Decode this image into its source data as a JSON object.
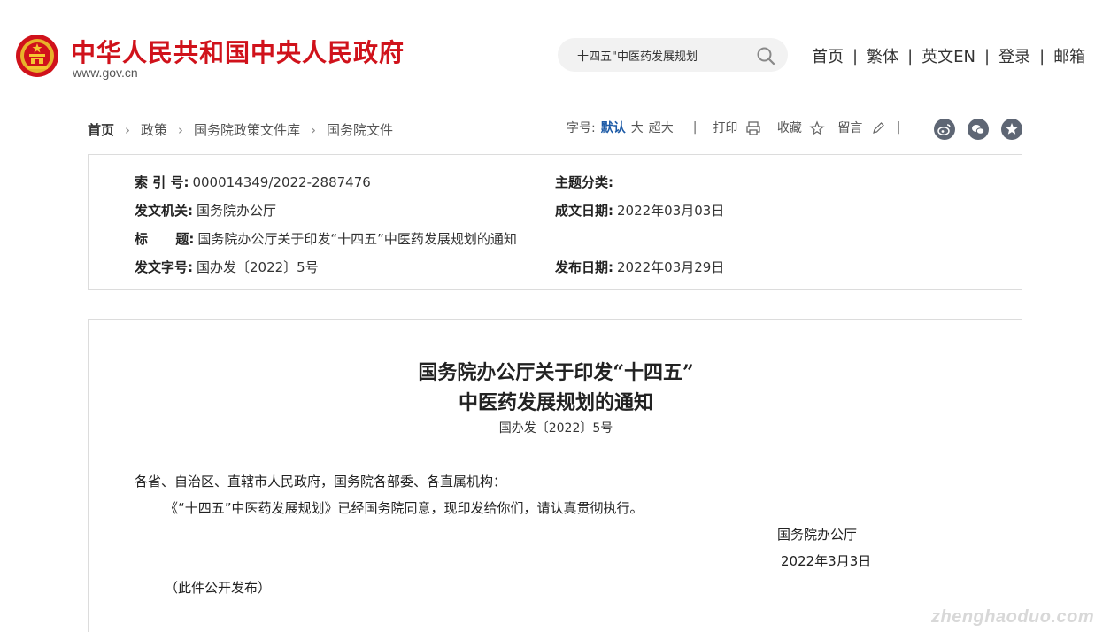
{
  "header": {
    "site_title": "中华人民共和国中央人民政府",
    "site_url": "www.gov.cn",
    "search_value": "十四五\"中医药发展规划",
    "nav": [
      "首页",
      "繁体",
      "英文EN",
      "登录",
      "邮箱"
    ],
    "separator": "|"
  },
  "breadcrumb": [
    "首页",
    "政策",
    "国务院政策文件库",
    "国务院文件"
  ],
  "tools": {
    "font_label": "字号:",
    "font_default": "默认",
    "font_large": "大",
    "font_xlarge": "超大",
    "print": "打印",
    "collect": "收藏",
    "comment": "留言"
  },
  "share_icons": [
    "weibo-icon",
    "wechat-icon",
    "star-share-icon"
  ],
  "meta": {
    "index_key": "索 引 号:",
    "index_val": "000014349/2022-2887476",
    "topic_key": "主题分类:",
    "topic_val": "",
    "issuer_key": "发文机关:",
    "issuer_val": "国务院办公厅",
    "written_key": "成文日期:",
    "written_val": "2022年03月03日",
    "title_key": "标      题:",
    "title_val": "国务院办公厅关于印发“十四五”中医药发展规划的通知",
    "docno_key": "发文字号:",
    "docno_val": "国办发〔2022〕5号",
    "published_key": "发布日期:",
    "published_val": "2022年03月29日"
  },
  "article": {
    "title_line1": "国务院办公厅关于印发“十四五”",
    "title_line2": "中医药发展规划的通知",
    "doc_number": "国办发〔2022〕5号",
    "salutation": "各省、自治区、直辖市人民政府，国务院各部委、各直属机构：",
    "body": "《“十四五”中医药发展规划》已经国务院同意，现印发给你们，请认真贯彻执行。",
    "signer": "国务院办公厅",
    "date": "2022年3月3日",
    "note": "（此件公开发布）"
  },
  "watermark": "zhenghaoduo.com",
  "colors": {
    "brand_red": "#d0121b",
    "link_blue": "#1c5aa6",
    "header_rule": "#4a5d80"
  }
}
